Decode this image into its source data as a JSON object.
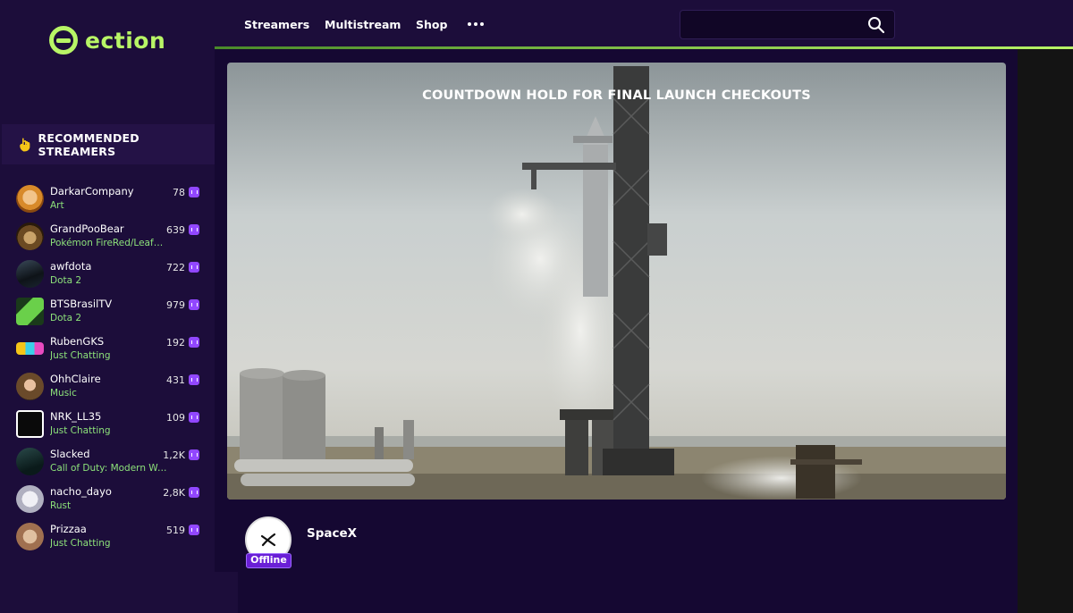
{
  "brand": {
    "logo_text": "ection",
    "accent": "#b8f566"
  },
  "nav": {
    "items": [
      "Streamers",
      "Multistream",
      "Shop"
    ],
    "more_icon": "more-dots-icon",
    "search": {
      "placeholder": "",
      "icon": "search-icon"
    }
  },
  "sidebar": {
    "section_title": "RECOMMENDED STREAMERS",
    "section_icon": "hand-icon",
    "streamers": [
      {
        "name": "DarkarCompany",
        "game": "Art",
        "viewers": "78",
        "platform_icon": "twitch-icon"
      },
      {
        "name": "GrandPooBear",
        "game": "Pokémon FireRed/LeafGreen",
        "viewers": "639",
        "platform_icon": "twitch-icon"
      },
      {
        "name": "awfdota",
        "game": "Dota 2",
        "viewers": "722",
        "platform_icon": "twitch-icon"
      },
      {
        "name": "BTSBrasilTV",
        "game": "Dota 2",
        "viewers": "979",
        "platform_icon": "twitch-icon"
      },
      {
        "name": "RubenGKS",
        "game": "Just Chatting",
        "viewers": "192",
        "platform_icon": "twitch-icon"
      },
      {
        "name": "OhhClaire",
        "game": "Music",
        "viewers": "431",
        "platform_icon": "twitch-icon"
      },
      {
        "name": "NRK_LL35",
        "game": "Just Chatting",
        "viewers": "109",
        "platform_icon": "twitch-icon"
      },
      {
        "name": "Slacked",
        "game": "Call of Duty: Modern Warfare",
        "viewers": "1,2K",
        "platform_icon": "twitch-icon"
      },
      {
        "name": "nacho_dayo",
        "game": "Rust",
        "viewers": "2,8K",
        "platform_icon": "twitch-icon"
      },
      {
        "name": "Prizzaa",
        "game": "Just Chatting",
        "viewers": "519",
        "platform_icon": "twitch-icon"
      }
    ]
  },
  "player": {
    "title": "COUNTDOWN HOLD FOR FINAL LAUNCH CHECKOUTS"
  },
  "channel": {
    "name": "SpaceX",
    "status": "Offline"
  }
}
